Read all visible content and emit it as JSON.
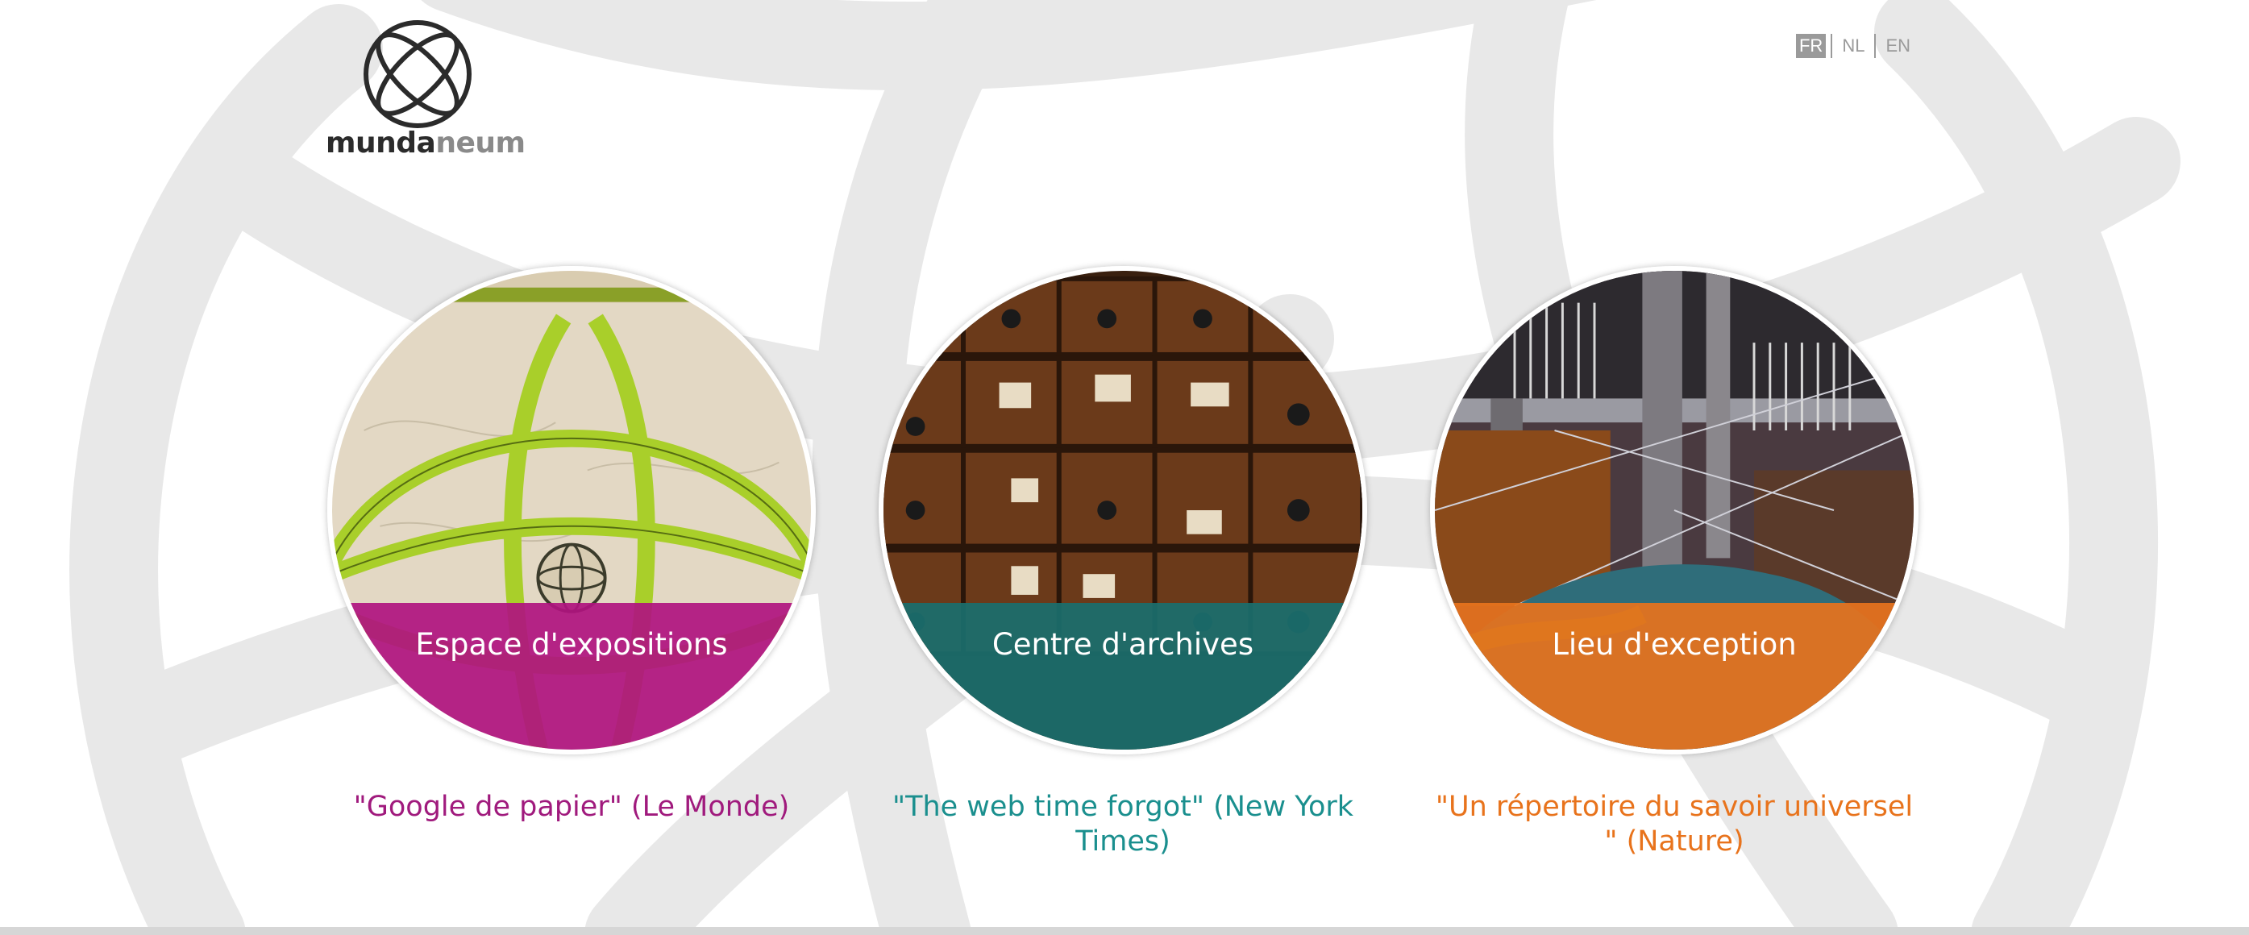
{
  "logo": {
    "text_part1": "munda",
    "text_part2": "neum"
  },
  "languages": [
    {
      "label": "FR",
      "active": true
    },
    {
      "label": "NL",
      "active": false
    },
    {
      "label": "EN",
      "active": false
    }
  ],
  "cards": [
    {
      "title": "Espace d'expositions",
      "quote": "\"Google de papier\" (Le Monde)",
      "color": "#b0147f"
    },
    {
      "title": "Centre d'archives",
      "quote": "\"The web time forgot\" (New York Times)",
      "color": "#1a6f6e"
    },
    {
      "title": "Lieu d'exception",
      "quote": "\"Un répertoire du savoir universel \" (Nature)",
      "color": "#e8731c"
    }
  ],
  "colors": {
    "magenta": "#b0147f",
    "teal": "#1a8f8e",
    "orange": "#e8731c",
    "background_pattern": "#e9e9e9"
  }
}
